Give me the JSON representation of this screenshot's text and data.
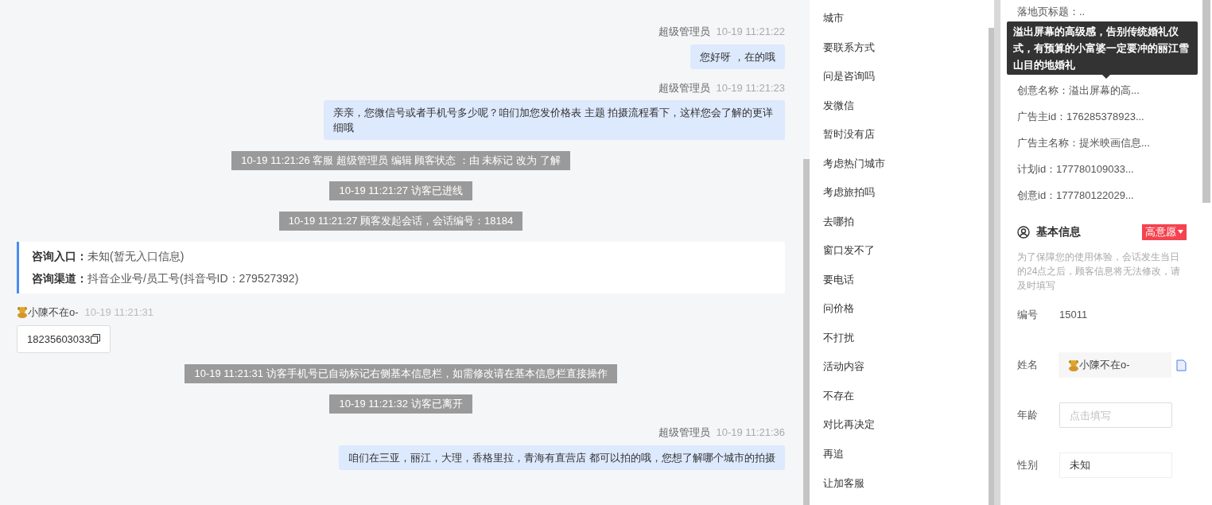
{
  "chat": {
    "messages": [
      {
        "kind": "agent",
        "sender": "超级管理员",
        "time": "10-19 11:21:22",
        "text": "您好呀 ，在的哦"
      },
      {
        "kind": "agent",
        "sender": "超级管理员",
        "time": "10-19 11:21:23",
        "text": "亲亲，您微信号或者手机号多少呢？咱们加您发价格表 主题 拍摄流程看下，这样您会了解的更详细哦"
      },
      {
        "kind": "system",
        "text": "10-19 11:21:26 客服 超级管理员 编辑 顾客状态 ：由 未标记 改为 了解"
      },
      {
        "kind": "system",
        "text": "10-19 11:21:27 访客已进线"
      },
      {
        "kind": "system",
        "text": "10-19 11:21:27 顾客发起会话，会话编号：18184"
      },
      {
        "kind": "info",
        "rows": [
          {
            "label": "咨询入口：",
            "value": "未知(暂无入口信息)"
          },
          {
            "label": "咨询渠道：",
            "value": "抖音企业号/员工号(抖音号ID：279527392)"
          }
        ]
      },
      {
        "kind": "visitor",
        "sender": "小陳不在o-",
        "time": "10-19 11:21:31",
        "text": "18235603033"
      },
      {
        "kind": "system",
        "text": "10-19 11:21:31 访客手机号已自动标记右侧基本信息栏，如需修改请在基本信息栏直接操作"
      },
      {
        "kind": "system",
        "text": "10-19 11:21:32 访客已离开"
      },
      {
        "kind": "agent",
        "sender": "超级管理员",
        "time": "10-19 11:21:36",
        "text": "咱们在三亚，丽江，大理，香格里拉，青海有直营店 都可以拍的哦，您想了解哪个城市的拍摄"
      }
    ]
  },
  "quick_replies": [
    "城市",
    "要联系方式",
    "问是咨询吗",
    "发微信",
    "暂时没有店",
    "考虑热门城市",
    "考虑旅拍吗",
    "去哪拍",
    "窗口发不了",
    "要电话",
    "问价格",
    "不打扰",
    "活动内容",
    "不存在",
    "对比再决定",
    "再追",
    "让加客服"
  ],
  "ad_info": [
    "落地页标题：..",
    "创意名称：溢出屏幕的高...",
    "广告主id：176285378923...",
    "广告主名称：提米映画信息...",
    "计划id：177780109033...",
    "创意id：177780122029..."
  ],
  "tooltip": "溢出屏幕的高级感，告别传统婚礼仪式，有预算的小富婆一定要冲的丽江雪山目的地婚礼",
  "basic_info": {
    "title": "基本信息",
    "intent_tag": {
      "label": "高意愿",
      "color": "#f5434f"
    },
    "notice": "为了保障您的使用体验，会话发生当日的24点之后，顾客信息将无法修改，请及时填写",
    "fields": [
      {
        "kind": "text",
        "label": "编号",
        "value": "15011"
      },
      {
        "kind": "name",
        "label": "姓名",
        "value": "小陳不在o-"
      },
      {
        "kind": "input",
        "label": "年龄",
        "placeholder": "点击填写"
      },
      {
        "kind": "select",
        "label": "性别",
        "value": "未知"
      }
    ]
  }
}
